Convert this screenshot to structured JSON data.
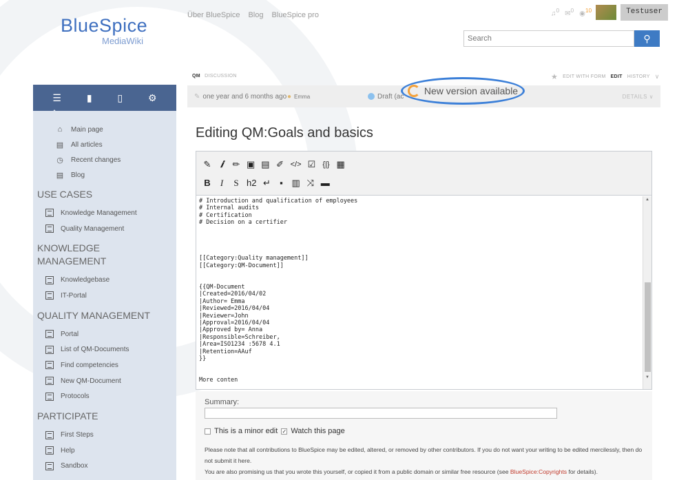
{
  "logo": {
    "main": "BlueSpice",
    "sub": "MediaWiki"
  },
  "topnav": [
    "Über BlueSpice",
    "Blog",
    "BlueSpice pro"
  ],
  "user": {
    "name": "Testuser",
    "notifications": [
      "0",
      "0",
      "10"
    ]
  },
  "search": {
    "placeholder": "Search",
    "button_icon": "search-icon"
  },
  "sidebar": {
    "tabs": [
      "menu-icon",
      "clipboard-icon",
      "book-icon",
      "gear-icon"
    ],
    "nav": [
      {
        "label": "Main page",
        "icon": "home-icon"
      },
      {
        "label": "All articles",
        "icon": "document-icon"
      },
      {
        "label": "Recent changes",
        "icon": "clock-icon"
      },
      {
        "label": "Blog",
        "icon": "document-icon"
      }
    ],
    "sections": [
      {
        "title": "USE CASES",
        "items": [
          "Knowledge Management",
          "Quality Management"
        ]
      },
      {
        "title": "KNOWLEDGE MANAGEMENT",
        "items": [
          "Knowledgebase",
          "IT-Portal"
        ]
      },
      {
        "title": "QUALITY MANAGEMENT",
        "items": [
          "Portal",
          "List of QM-Documents",
          "Find competencies",
          "New QM-Document",
          "Protocols"
        ]
      },
      {
        "title": "PARTICIPATE",
        "items": [
          "First Steps",
          "Help",
          "Sandbox"
        ]
      }
    ]
  },
  "content": {
    "namespace": "QM",
    "discussion": "DISCUSSION",
    "actions": {
      "edit_with_form": "EDIT WITH FORM",
      "edit": "EDIT",
      "history": "HISTORY"
    },
    "info": {
      "time": "one year and 6 months ago",
      "author": "Emma",
      "status": "Draft (ac",
      "new_version": "New version available",
      "details": "DETAILS"
    },
    "title": "Editing QM:Goals and basics",
    "toolbar": {
      "row1": [
        "✎",
        "𝒊",
        "✏",
        "▣",
        "▤",
        "✐",
        "</>",
        "☑",
        "{|}",
        "▦"
      ],
      "row2": [
        "B",
        "I",
        "S",
        "h2",
        "↵",
        "▪",
        "▥",
        "⤨",
        "▬"
      ]
    },
    "text": "# Introduction and qualification of employees\n# Internal audits\n# Certification\n# Decision on a certifier\n\n\n\n\n[[Category:Quality management]]\n[[Category:QM-Document]]\n\n\n{{QM-Document\n|Created=2016/04/02\n|Author= Emma\n|Reviewed=2016/04/04\n|Reviewer=John\n|Approval=2016/04/04\n|Approved by= Anna\n|Responsible=Schreiber,\n|Area=ISO1234 :5678 4.1\n|Retention=AAuf\n}}\n\n\nMore conten",
    "summary_label": "Summary:",
    "minor_edit": "This is a minor edit",
    "watch": "Watch this page",
    "notice1": "Please note that all contributions to BlueSpice may be edited, altered, or removed by other contributors. If you do not want your writing to be edited mercilessly, then do not submit it here.",
    "notice2_pre": "You are also promising us that you wrote this yourself, or copied it from a public domain or similar free resource (see ",
    "notice2_link": "BlueSpice:Copyrights",
    "notice2_post": " for details)."
  }
}
